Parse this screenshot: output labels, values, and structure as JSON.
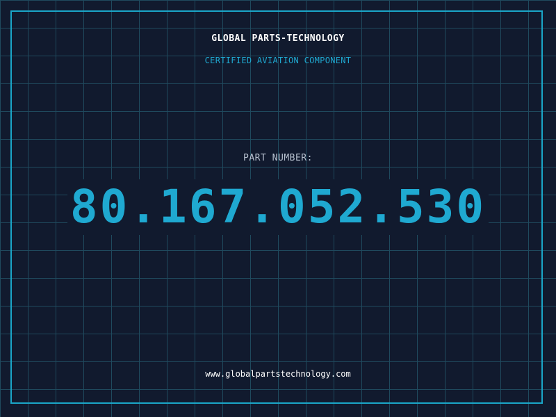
{
  "header": {
    "company": "GLOBAL PARTS-TECHNOLOGY",
    "tagline": "CERTIFIED AVIATION COMPONENT"
  },
  "part": {
    "label": "PART NUMBER:",
    "number": "80.167.052.530"
  },
  "footer": {
    "url": "www.globalpartstechnology.com"
  },
  "colors": {
    "background": "#111a2e",
    "grid": "#1f4a5e",
    "accent": "#1fa9d1",
    "text": "#ffffff",
    "label": "#b8c2d0"
  }
}
